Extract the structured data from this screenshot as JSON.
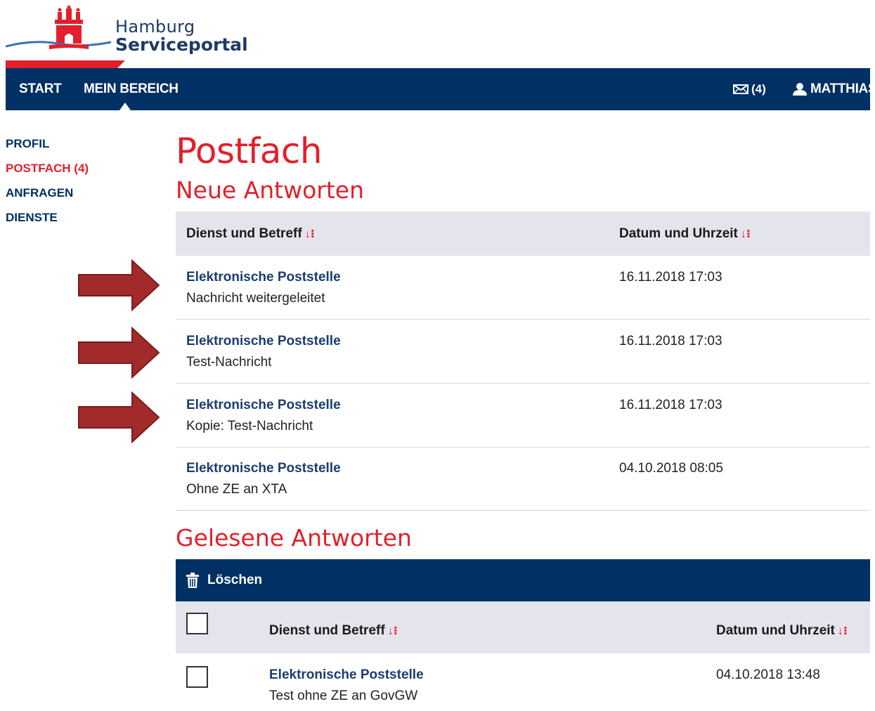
{
  "brand": {
    "line1": "Hamburg",
    "line2": "Serviceportal",
    "colors": {
      "navy": "#003064",
      "red": "#e31f2b"
    }
  },
  "nav": {
    "start": "START",
    "mein_bereich": "MEIN BEREICH",
    "mail_icon": "envelope-icon",
    "mail_count": "(4)",
    "user_icon": "user-icon",
    "user": "MATTHIAS"
  },
  "sidebar": {
    "items": [
      {
        "label": "PROFIL",
        "active": false
      },
      {
        "label": "POSTFACH (4)",
        "active": true
      },
      {
        "label": "ANFRAGEN",
        "active": false
      },
      {
        "label": "DIENSTE",
        "active": false
      }
    ]
  },
  "main": {
    "title": "Postfach",
    "neue": {
      "heading": "Neue Antworten",
      "col1": "Dienst und Betreff",
      "col2": "Datum und Uhrzeit",
      "rows": [
        {
          "title": "Elektronische Poststelle",
          "subject": "Nachricht weitergeleitet",
          "date": "16.11.2018 17:03"
        },
        {
          "title": "Elektronische Poststelle",
          "subject": "Test-Nachricht",
          "date": "16.11.2018 17:03"
        },
        {
          "title": "Elektronische Poststelle",
          "subject": "Kopie: Test-Nachricht",
          "date": "16.11.2018 17:03"
        },
        {
          "title": "Elektronische Poststelle",
          "subject": "Ohne ZE an XTA",
          "date": "04.10.2018 08:05"
        }
      ]
    },
    "gelesene": {
      "heading": "Gelesene Antworten",
      "delete_label": "Löschen",
      "delete_icon": "trash-icon",
      "col1": "Dienst und Betreff",
      "col2": "Datum und Uhrzeit",
      "rows": [
        {
          "title": "Elektronische Poststelle",
          "subject": "Test ohne ZE an GovGW",
          "date": "04.10.2018 13:48"
        }
      ]
    }
  }
}
